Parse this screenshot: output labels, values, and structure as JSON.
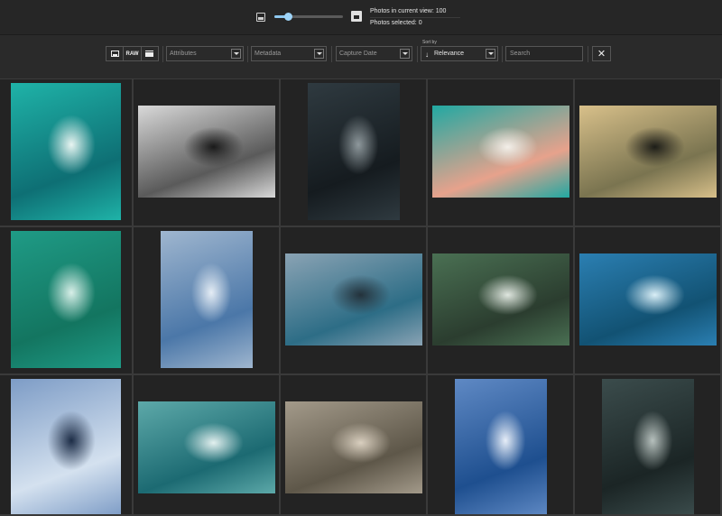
{
  "toolbar": {
    "zoom_small_icon": "small-image-icon",
    "zoom_large_icon": "large-image-icon",
    "zoom_level": 0.2,
    "photos_in_view": "Photos in current view: 100",
    "photos_selected": "Photos selected: 0"
  },
  "filters": {
    "type_buttons": [
      {
        "icon": "photo-icon",
        "label": ""
      },
      {
        "icon": "raw-icon",
        "label": "RAW"
      },
      {
        "icon": "video-icon",
        "label": ""
      }
    ],
    "attributes_placeholder": "Attributes",
    "metadata_placeholder": "Metadata",
    "capture_date_placeholder": "Capture Date",
    "sort_label": "Sort by",
    "sort_value": "Relevance",
    "search_placeholder": "Search",
    "close_icon": "close-icon",
    "collapse_icon": "chevron-up-icon"
  },
  "photos": [
    {
      "subject": "Aerial surfer on turquoise ocean",
      "palette": [
        "#1fb3a8",
        "#0e6f74",
        "#e9f5f2"
      ],
      "orientation": "portrait"
    },
    {
      "subject": "Black and white breaking wave",
      "palette": [
        "#d9d9d9",
        "#5a5a5a",
        "#1a1a1a"
      ],
      "orientation": "landscape"
    },
    {
      "subject": "Dark shoreline aerial",
      "palette": [
        "#2f3a40",
        "#151b1f",
        "#8e989c"
      ],
      "orientation": "portrait"
    },
    {
      "subject": "Aerial beach with pink sand",
      "palette": [
        "#21a8a2",
        "#e7a28c",
        "#f3efe9"
      ],
      "orientation": "landscape"
    },
    {
      "subject": "Surfer silhouette at sunset",
      "palette": [
        "#d8c08a",
        "#7a7450",
        "#1d1d18"
      ],
      "orientation": "landscape"
    },
    {
      "subject": "Surfer paddling in green water",
      "palette": [
        "#1f9b86",
        "#137560",
        "#d8efe8"
      ],
      "orientation": "portrait"
    },
    {
      "subject": "Surfer on blue wave",
      "palette": [
        "#9fb6cf",
        "#4b77a8",
        "#e5edf5"
      ],
      "orientation": "portrait"
    },
    {
      "subject": "Surfer at dusk on teal wave",
      "palette": [
        "#8aa3b4",
        "#2d6d86",
        "#24323b"
      ],
      "orientation": "landscape"
    },
    {
      "subject": "Surfer on green curling wave",
      "palette": [
        "#4a7053",
        "#2b3d2f",
        "#dfe6df"
      ],
      "orientation": "landscape"
    },
    {
      "subject": "Surfer inside blue barrel",
      "palette": [
        "#2b7fb2",
        "#125273",
        "#d9eef6"
      ],
      "orientation": "landscape"
    },
    {
      "subject": "Woman surfing at dawn",
      "palette": [
        "#7d9cc6",
        "#d4e1ef",
        "#1c2c46"
      ],
      "orientation": "portrait"
    },
    {
      "subject": "Teal wave curl",
      "palette": [
        "#5da9a9",
        "#1c6a72",
        "#e3f0ef"
      ],
      "orientation": "landscape"
    },
    {
      "subject": "Surfer in sepia swell",
      "palette": [
        "#a39a8a",
        "#5e5749",
        "#d9cfbf"
      ],
      "orientation": "landscape"
    },
    {
      "subject": "Surfer in blue whitewater",
      "palette": [
        "#5f89c4",
        "#1e4f8f",
        "#e7eef8"
      ],
      "orientation": "portrait"
    },
    {
      "subject": "Dark sea foam aerial",
      "palette": [
        "#3b4c4c",
        "#1b2525",
        "#b6c0bd"
      ],
      "orientation": "portrait"
    }
  ]
}
